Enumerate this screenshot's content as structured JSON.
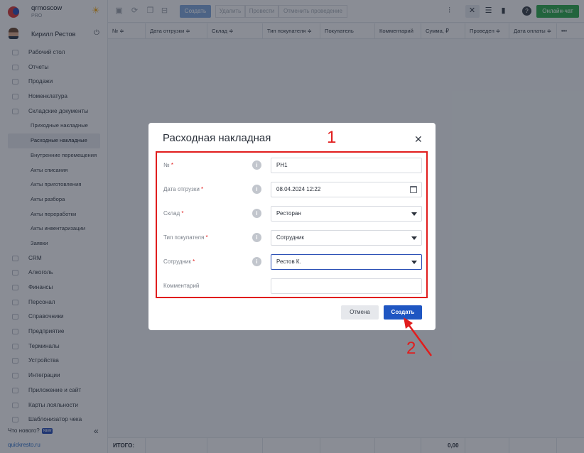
{
  "brand": {
    "name": "qrmoscow",
    "plan": "PRO"
  },
  "user": {
    "name": "Кирилл Рестов"
  },
  "sidebar": {
    "items": [
      {
        "label": "Рабочий стол"
      },
      {
        "label": "Отчеты"
      },
      {
        "label": "Продажи"
      },
      {
        "label": "Номенклатура"
      },
      {
        "label": "Складские документы"
      }
    ],
    "subitems": [
      {
        "label": "Приходные накладные"
      },
      {
        "label": "Расходные накладные"
      },
      {
        "label": "Внутренние перемещения"
      },
      {
        "label": "Акты списания"
      },
      {
        "label": "Акты приготовления"
      },
      {
        "label": "Акты разбора"
      },
      {
        "label": "Акты переработки"
      },
      {
        "label": "Акты инвентаризации"
      },
      {
        "label": "Заявки"
      }
    ],
    "items_after": [
      {
        "label": "CRM"
      },
      {
        "label": "Алкоголь"
      },
      {
        "label": "Финансы"
      },
      {
        "label": "Персонал"
      },
      {
        "label": "Справочники"
      },
      {
        "label": "Предприятие"
      },
      {
        "label": "Терминалы"
      },
      {
        "label": "Устройства"
      },
      {
        "label": "Интеграции"
      },
      {
        "label": "Приложение и сайт"
      },
      {
        "label": "Карты лояльности"
      },
      {
        "label": "Шаблонизатор чека"
      }
    ],
    "whats_new": "Что нового?",
    "new_badge": "NEW",
    "domain": "quickresto.ru"
  },
  "toolbar": {
    "create_label": "Создать",
    "delete_label": "Удалить",
    "post_label": "Провести",
    "unpost_label": "Отменить проведение",
    "chat_label": "Онлайн-чат"
  },
  "table": {
    "columns": [
      "№ ≑",
      "Дата отгрузки ≑",
      "Склад ≑",
      "Тип покупателя ≑",
      "Покупатель",
      "Комментарий",
      "Сумма, ₽",
      "Проведен ≑",
      "Дата оплаты ≑",
      "•••"
    ],
    "total_label": "ИТОГО:",
    "total_sum": "0,00"
  },
  "modal": {
    "title": "Расходная накладная",
    "close": "✕",
    "fields": [
      {
        "label": "№",
        "value": "РН1"
      },
      {
        "label": "Дата отгрузки",
        "value": "08.04.2024 12:22"
      },
      {
        "label": "Склад",
        "value": "Ресторан"
      },
      {
        "label": "Тип покупателя",
        "value": "Сотрудник"
      },
      {
        "label": "Сотрудник",
        "value": "Рестов К."
      },
      {
        "label": "Комментарий",
        "value": ""
      }
    ],
    "cancel_label": "Отмена",
    "create_label": "Создать"
  },
  "annotations": {
    "step1": "1",
    "step2": "2",
    "color": "#e11d1d"
  }
}
